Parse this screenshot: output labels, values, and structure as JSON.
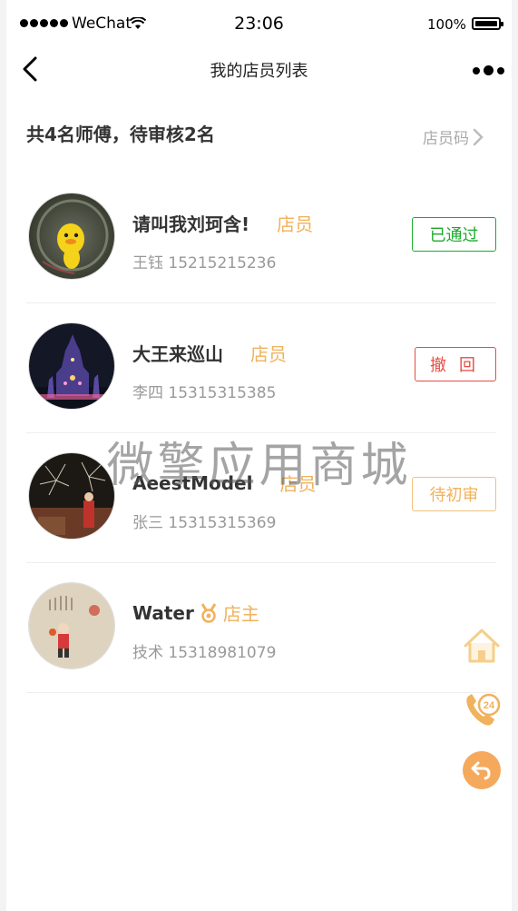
{
  "status_bar": {
    "carrier": "WeChat",
    "time": "23:06",
    "battery": "100%"
  },
  "nav": {
    "title": "我的店员列表"
  },
  "summary": {
    "text": "共4名师傅，待审核2名",
    "shop_code_label": "店员码"
  },
  "staff": [
    {
      "name": "请叫我刘珂含!",
      "role": "店员",
      "dept": "王钰",
      "phone": "15215215236",
      "action": "已通过",
      "action_color": "#1aaa2a"
    },
    {
      "name": "大王来巡山",
      "role": "店员",
      "dept": "李四",
      "phone": "15315315385",
      "action": "撤回",
      "action_color": "#e54d42"
    },
    {
      "name": "AeestModel",
      "role": "店员",
      "dept": "张三",
      "phone": "15315315369",
      "action": "待初审",
      "action_color": "#f0b25c"
    },
    {
      "name": "Water",
      "role": "店主",
      "dept": "技术",
      "phone": "15318981079",
      "action": "",
      "action_color": ""
    }
  ],
  "watermark": "微擎应用商城",
  "floating_buttons": [
    "home-icon",
    "phone-24-icon",
    "back-arrow-icon"
  ],
  "colors": {
    "role": "#f0b25c",
    "approved": "#1aaa2a",
    "revoke": "#e54d42",
    "pending": "#f0b25c"
  }
}
